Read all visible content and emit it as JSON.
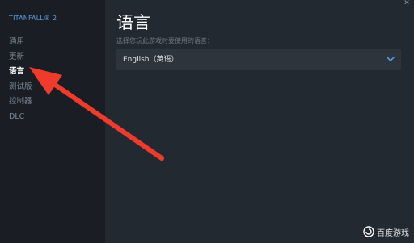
{
  "sidebar": {
    "game_title": "TITANFALL® 2",
    "items": [
      {
        "label": "通用"
      },
      {
        "label": "更新"
      },
      {
        "label": "语言"
      },
      {
        "label": "测试版"
      },
      {
        "label": "控制器"
      },
      {
        "label": "DLC"
      }
    ],
    "active_index": 2
  },
  "main": {
    "title": "语言",
    "field_label": "选择您玩此游戏时要使用的语言：",
    "selected_language": "English（英语）"
  },
  "overlay": {
    "arrow_color": "#ee3b2c"
  },
  "watermark": {
    "text": "百度游戏"
  },
  "colors": {
    "sidebar_bg": "#1a1e24",
    "main_bg": "#232931",
    "title_accent": "#5c9ee0",
    "chevron": "#4a9de0"
  }
}
